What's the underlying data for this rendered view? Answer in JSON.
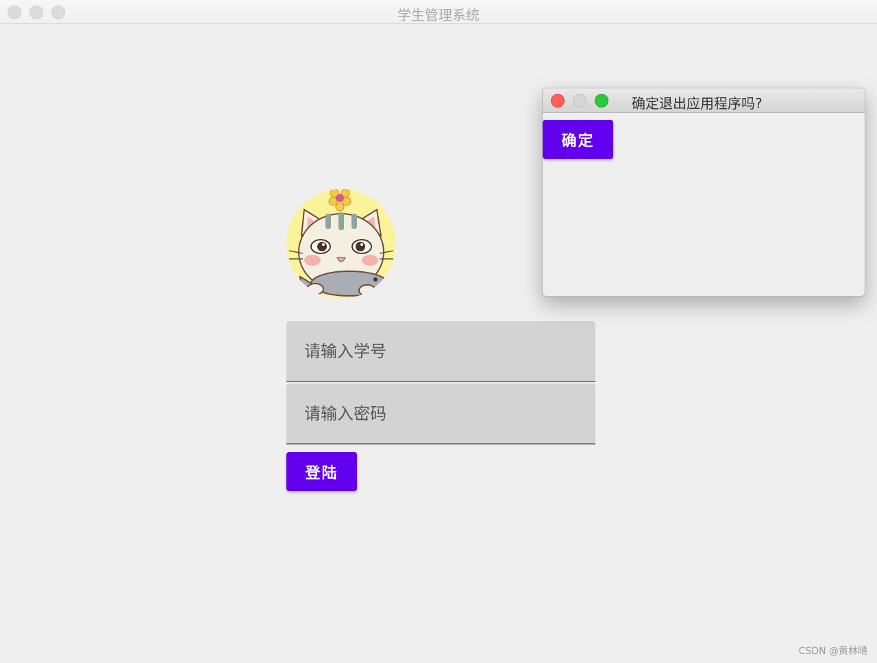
{
  "window": {
    "title": "学生管理系统"
  },
  "login": {
    "student_id_placeholder": "请输入学号",
    "password_placeholder": "请输入密码",
    "login_label": "登陆"
  },
  "dialog": {
    "title": "确定退出应用程序吗?",
    "confirm_label": "确定"
  },
  "watermark": "CSDN @黄林晴",
  "colors": {
    "accent": "#6200ee",
    "field_bg": "#d3d3d3",
    "window_bg": "#efefef"
  },
  "icons": {
    "avatar": "cartoon-cat-avatar-icon"
  }
}
